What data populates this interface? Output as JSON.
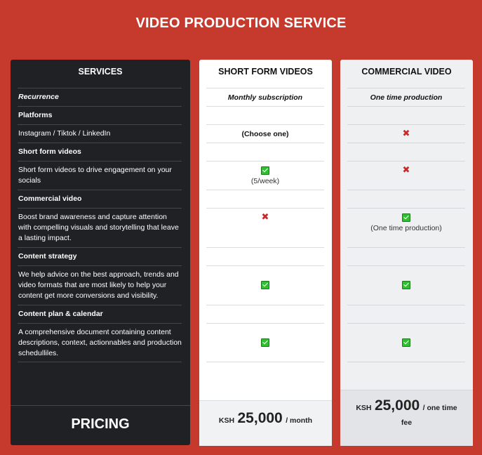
{
  "page": {
    "title": "VIDEO PRODUCTION SERVICE"
  },
  "colors": {
    "background": "#c53a2c",
    "services_panel": "#1f2125",
    "check": "#2ec02e",
    "cross": "#c82a2a"
  },
  "services": {
    "header": "SERVICES",
    "rows": [
      "Recurrence",
      "Platforms",
      "Instagram / Tiktok / LinkedIn",
      "Short form videos",
      "Short form videos to drive engagement on your socials",
      "Commercial video",
      "Boost brand awareness and capture attention with compelling visuals and storytelling that leave a lasting impact.",
      "Content strategy",
      "We help advice on the best approach, trends and video formats that are most likely to help your content get more conversions and visibility.",
      "Content plan & calendar",
      "A comprehensive document containing content descriptions, context, actionnables and production schedulliles."
    ],
    "pricing_label": "PRICING"
  },
  "short_form": {
    "header": "SHORT FORM VIDEOS",
    "recurrence": "Monthly subscription",
    "platforms_note": "(Choose one)",
    "short_videos_note": "(5/week)",
    "price": {
      "currency": "KSH",
      "amount": "25,000",
      "period": "/ month"
    }
  },
  "commercial": {
    "header": "COMMERCIAL VIDEO",
    "recurrence": "One time production",
    "commercial_note": "(One time production)",
    "price": {
      "currency": "KSH",
      "amount": "25,000",
      "period": "/ one time",
      "period2": "fee"
    }
  },
  "icons": {
    "check": "check-icon",
    "cross": "cross-icon",
    "cross_glyph": "✖"
  }
}
